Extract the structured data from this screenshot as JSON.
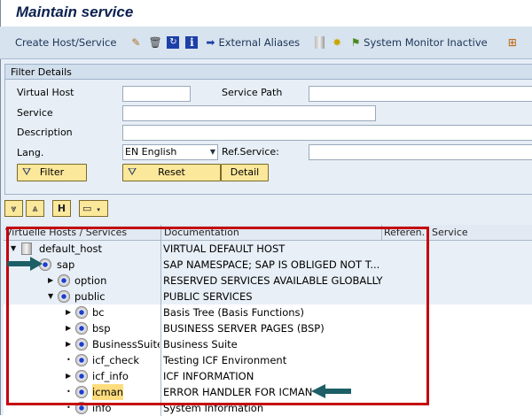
{
  "title": "Maintain service",
  "toolbar": {
    "create": "Create Host/Service",
    "external_aliases": "External Aliases",
    "system_monitor": "System Monitor Inactive"
  },
  "filter": {
    "header": "Filter Details",
    "virtual_host": "Virtual Host",
    "service_path": "Service Path",
    "service": "Service",
    "description": "Description",
    "lang": "Lang.",
    "lang_value": "EN English",
    "ref_service": "Ref.Service:",
    "filter_btn": "Filter",
    "reset_btn": "Reset",
    "detail_btn": "Detail"
  },
  "grid": {
    "headers": [
      "Virtuelle Hosts / Services",
      "Documentation",
      "Referen.",
      "Service"
    ],
    "rows": [
      {
        "name": "default_host",
        "doc": "VIRTUAL DEFAULT HOST"
      },
      {
        "name": "sap",
        "doc": "SAP NAMESPACE; SAP IS OBLIGED NOT T..."
      },
      {
        "name": "option",
        "doc": "RESERVED SERVICES AVAILABLE GLOBALLY"
      },
      {
        "name": "public",
        "doc": "PUBLIC SERVICES"
      },
      {
        "name": "bc",
        "doc": "Basis Tree (Basis Functions)"
      },
      {
        "name": "bsp",
        "doc": "BUSINESS SERVER PAGES (BSP)"
      },
      {
        "name": "BusinessSuite",
        "doc": "Business Suite"
      },
      {
        "name": "icf_check",
        "doc": "Testing ICF Environment"
      },
      {
        "name": "icf_info",
        "doc": "ICF INFORMATION"
      },
      {
        "name": "icman",
        "doc": "ERROR HANDLER FOR ICMAN"
      },
      {
        "name": "info",
        "doc": "System Information"
      }
    ]
  },
  "colors": {
    "highlight_box": "#c4000d",
    "arrow": "#1c5f66",
    "selected": "#ffdc7e"
  }
}
